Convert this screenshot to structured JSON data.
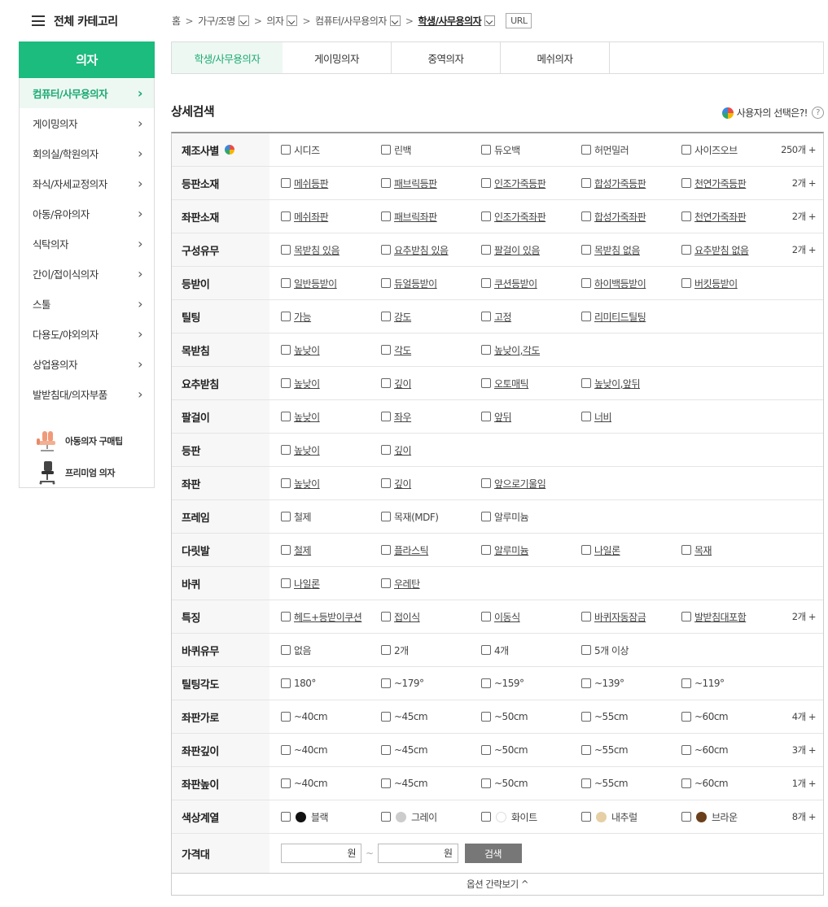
{
  "category_header": {
    "label": "전체 카테고리"
  },
  "sidebar": {
    "title": "의자",
    "items": [
      {
        "label": "컴퓨터/사무용의자"
      },
      {
        "label": "게이밍의자"
      },
      {
        "label": "회의실/학원의자"
      },
      {
        "label": "좌식/자세교정의자"
      },
      {
        "label": "아동/유아의자"
      },
      {
        "label": "식탁의자"
      },
      {
        "label": "간이/접이식의자"
      },
      {
        "label": "스툴"
      },
      {
        "label": "다용도/야외의자"
      },
      {
        "label": "상업용의자"
      },
      {
        "label": "발받침대/의자부품"
      }
    ],
    "extras": [
      {
        "label": "아동의자 구매팁"
      },
      {
        "label": "프리미엄 의자"
      }
    ]
  },
  "breadcrumb": {
    "home": "홈",
    "c1": "가구/조명",
    "c2": "의자",
    "c3": "컴퓨터/사무용의자",
    "c4": "학생/사무용의자",
    "url_button": "URL"
  },
  "tabs": [
    {
      "label": "학생/사무용의자"
    },
    {
      "label": "게이밍의자"
    },
    {
      "label": "중역의자"
    },
    {
      "label": "메쉬의자"
    }
  ],
  "detail": {
    "title": "상세검색",
    "user_choice": "사용자의 선택은?!",
    "help": "?"
  },
  "filters": [
    {
      "label": "제조사별",
      "options": [
        "시디즈",
        "린백",
        "듀오백",
        "허먼밀러",
        "사이즈오브"
      ],
      "more": "250개 +"
    },
    {
      "label": "등판소재",
      "options": [
        "메쉬등판",
        "패브릭등판",
        "인조가죽등판",
        "합성가죽등판",
        "천연가죽등판"
      ],
      "more": "2개 +"
    },
    {
      "label": "좌판소재",
      "options": [
        "메쉬좌판",
        "패브릭좌판",
        "인조가죽좌판",
        "합성가죽좌판",
        "천연가죽좌판"
      ],
      "more": "2개 +"
    },
    {
      "label": "구성유무",
      "options": [
        "목받침 있음",
        "요추받침 있음",
        "팔걸이 있음",
        "목받침 없음",
        "요추받침 없음"
      ],
      "more": "2개 +"
    },
    {
      "label": "등받이",
      "options": [
        "일반등받이",
        "듀얼등받이",
        "쿠션등받이",
        "하이백등받이",
        "버킷등받이"
      ]
    },
    {
      "label": "틸팅",
      "options": [
        "가능",
        "강도",
        "고정",
        "리미티드틸팅"
      ]
    },
    {
      "label": "목받침",
      "options": [
        "높낮이",
        "각도",
        "높낮이,각도"
      ]
    },
    {
      "label": "요추받침",
      "options": [
        "높낮이",
        "깊이",
        "오토매틱",
        "높낮이,앞뒤"
      ]
    },
    {
      "label": "팔걸이",
      "options": [
        "높낮이",
        "좌우",
        "앞뒤",
        "너비"
      ]
    },
    {
      "label": "등판",
      "options": [
        "높낮이",
        "깊이"
      ]
    },
    {
      "label": "좌판",
      "options": [
        "높낮이",
        "깊이",
        "앞으로기울임"
      ]
    },
    {
      "label": "프레임",
      "options": [
        "철제",
        "목재(MDF)",
        "알루미늄"
      ]
    },
    {
      "label": "다릿발",
      "options": [
        "철제",
        "플라스틱",
        "알루미늄",
        "나일론",
        "목재"
      ]
    },
    {
      "label": "바퀴",
      "options": [
        "나일론",
        "우레탄"
      ]
    },
    {
      "label": "특징",
      "options": [
        "헤드+등받이쿠션",
        "접이식",
        "이동식",
        "바퀴자동잠금",
        "발받침대포함"
      ],
      "more": "2개 +"
    },
    {
      "label": "바퀴유무",
      "options": [
        "없음",
        "2개",
        "4개",
        "5개 이상"
      ]
    },
    {
      "label": "틸팅각도",
      "options": [
        "180°",
        "~179°",
        "~159°",
        "~139°",
        "~119°"
      ]
    },
    {
      "label": "좌판가로",
      "options": [
        "~40cm",
        "~45cm",
        "~50cm",
        "~55cm",
        "~60cm"
      ],
      "more": "4개 +"
    },
    {
      "label": "좌판깊이",
      "options": [
        "~40cm",
        "~45cm",
        "~50cm",
        "~55cm",
        "~60cm"
      ],
      "more": "3개 +"
    },
    {
      "label": "좌판높이",
      "options": [
        "~40cm",
        "~45cm",
        "~50cm",
        "~55cm",
        "~60cm"
      ],
      "more": "1개 +"
    }
  ],
  "color_filter": {
    "label": "색상계열",
    "options": [
      {
        "label": "블랙",
        "color": "#111111"
      },
      {
        "label": "그레이",
        "color": "#cccccc"
      },
      {
        "label": "화이트",
        "color": "#ffffff"
      },
      {
        "label": "내추럴",
        "color": "#e6cfa5"
      },
      {
        "label": "브라운",
        "color": "#6b3f1c"
      }
    ],
    "more": "8개 +"
  },
  "price": {
    "label": "가격대",
    "unit": "원",
    "tilde": "~",
    "search": "검색"
  },
  "fold": {
    "label": "옵션 간략보기 ^"
  },
  "colors": {
    "accent": "#1cbb7e",
    "accent_text": "#1aaa72"
  }
}
